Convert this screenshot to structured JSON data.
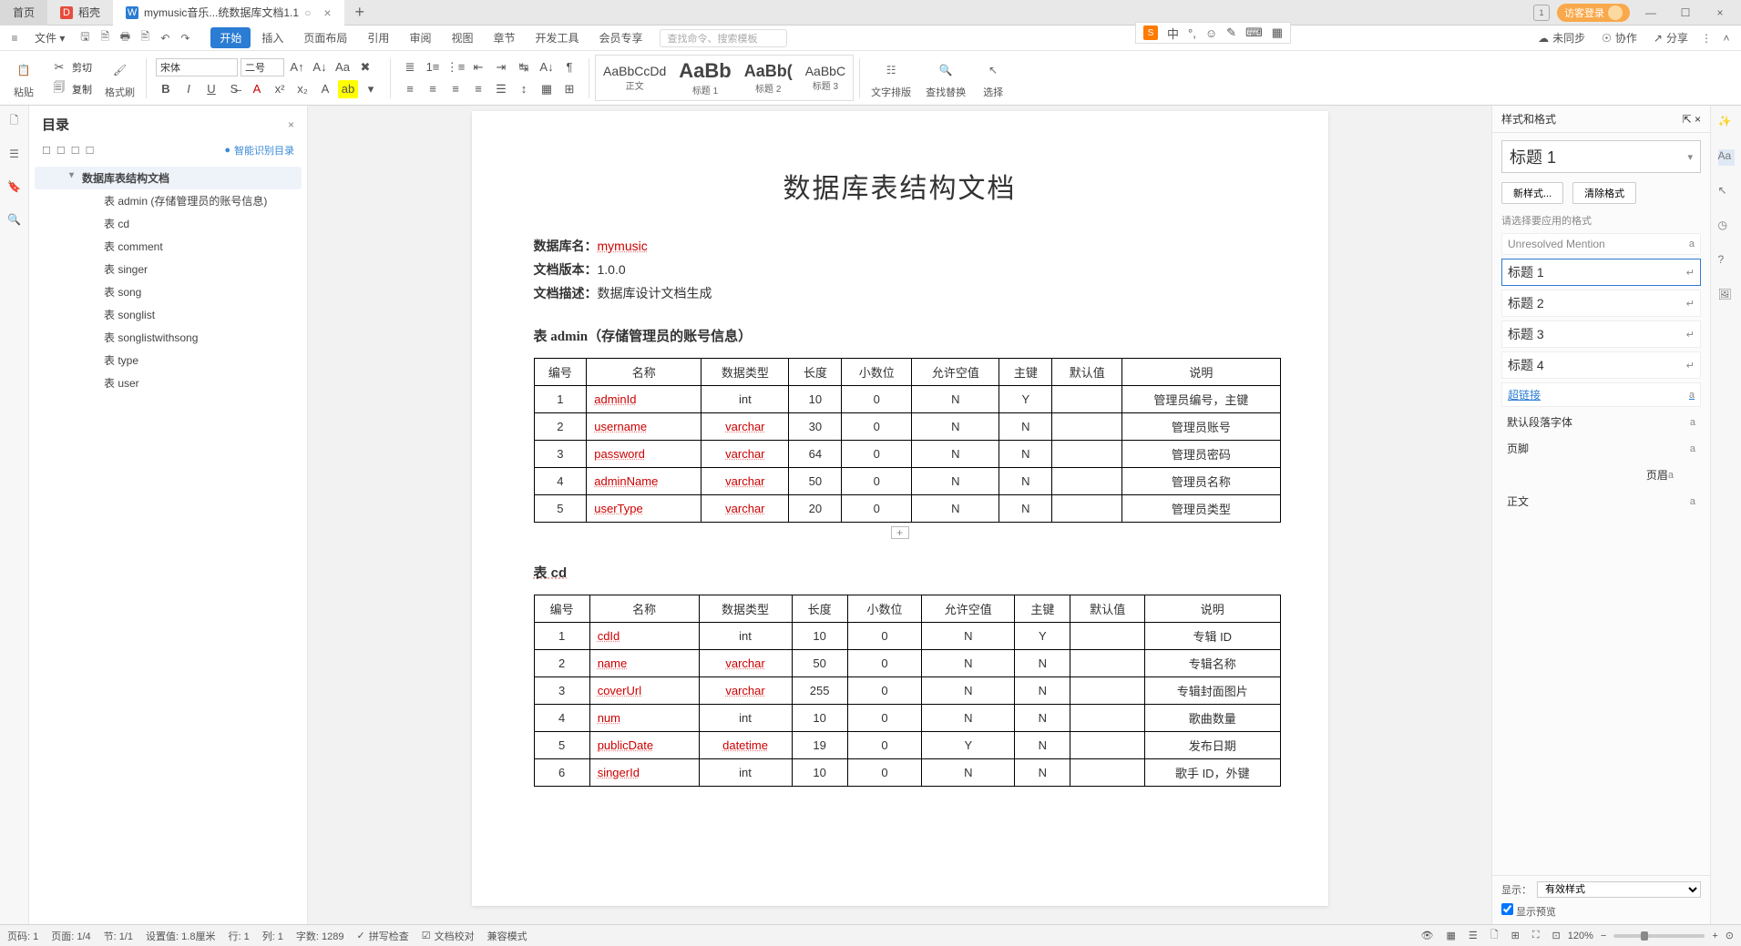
{
  "titlebar": {
    "home_tab": "首页",
    "shell_tab": "稻壳",
    "doc_tab": "mymusic音乐...统数据库文档1.1",
    "login": "访客登录"
  },
  "menubar": {
    "file": "文件",
    "start": "开始",
    "items": [
      "插入",
      "页面布局",
      "引用",
      "审阅",
      "视图",
      "章节",
      "开发工具",
      "会员专享"
    ],
    "search_ph": "查找命令、搜索模板",
    "right": {
      "sync": "未同步",
      "collab": "协作",
      "share": "分享"
    }
  },
  "ribbon": {
    "paste": "粘贴",
    "cut": "剪切",
    "copy": "复制",
    "fmt": "格式刷",
    "font": "宋体",
    "size": "二号",
    "styles": {
      "normal": "正文",
      "h1": "标题 1",
      "h2": "标题 2",
      "h3": "标题 3"
    },
    "text_layout": "文字排版",
    "find": "查找替换",
    "select": "选择"
  },
  "outline": {
    "title": "目录",
    "smart": "智能识别目录",
    "root": "数据库表结构文档",
    "items": [
      "表 admin (存储管理员的账号信息)",
      "表 cd",
      "表 comment",
      "表 singer",
      "表 song",
      "表 songlist",
      "表 songlistwithsong",
      "表 type",
      "表 user"
    ]
  },
  "doc": {
    "title": "数据库表结构文档",
    "db_label": "数据库名：",
    "db_name": "mymusic",
    "ver_label": "文档版本：",
    "ver": "1.0.0",
    "desc_label": "文档描述：",
    "desc": "数据库设计文档生成",
    "sect_admin": "表 admin（存储管理员的账号信息）",
    "sect_cd": "表 cd",
    "cols": [
      "编号",
      "名称",
      "数据类型",
      "长度",
      "小数位",
      "允许空值",
      "主键",
      "默认值",
      "说明"
    ],
    "admin_rows": [
      [
        "1",
        "adminId",
        "int",
        "10",
        "0",
        "N",
        "Y",
        "",
        "管理员编号，主键"
      ],
      [
        "2",
        "username",
        "varchar",
        "30",
        "0",
        "N",
        "N",
        "",
        "管理员账号"
      ],
      [
        "3",
        "password",
        "varchar",
        "64",
        "0",
        "N",
        "N",
        "",
        "管理员密码"
      ],
      [
        "4",
        "adminName",
        "varchar",
        "50",
        "0",
        "N",
        "N",
        "",
        "管理员名称"
      ],
      [
        "5",
        "userType",
        "varchar",
        "20",
        "0",
        "N",
        "N",
        "",
        "管理员类型"
      ]
    ],
    "cd_rows": [
      [
        "1",
        "cdId",
        "int",
        "10",
        "0",
        "N",
        "Y",
        "",
        "专辑 ID"
      ],
      [
        "2",
        "name",
        "varchar",
        "50",
        "0",
        "N",
        "N",
        "",
        "专辑名称"
      ],
      [
        "3",
        "coverUrl",
        "varchar",
        "255",
        "0",
        "N",
        "N",
        "",
        "专辑封面图片"
      ],
      [
        "4",
        "num",
        "int",
        "10",
        "0",
        "N",
        "N",
        "",
        "歌曲数量"
      ],
      [
        "5",
        "publicDate",
        "datetime",
        "19",
        "0",
        "Y",
        "N",
        "",
        "发布日期"
      ],
      [
        "6",
        "singerId",
        "int",
        "10",
        "0",
        "N",
        "N",
        "",
        "歌手 ID，外键"
      ]
    ]
  },
  "styles": {
    "panel": "样式和格式",
    "current": "标题 1",
    "new_style": "新样式...",
    "clear": "清除格式",
    "hint": "请选择要应用的格式",
    "items": [
      {
        "label": "Unresolved Mention",
        "cls": "gray"
      },
      {
        "label": "标题 1",
        "cls": "sel"
      },
      {
        "label": "标题 2",
        "cls": ""
      },
      {
        "label": "标题 3",
        "cls": ""
      },
      {
        "label": "标题 4",
        "cls": ""
      },
      {
        "label": "超链接",
        "cls": "link"
      },
      {
        "label": "默认段落字体",
        "cls": "small"
      },
      {
        "label": "页脚",
        "cls": "small"
      },
      {
        "label": "页眉",
        "cls": "small ta-r"
      },
      {
        "label": "正文",
        "cls": "small"
      }
    ],
    "show_label": "显示：",
    "show_value": "有效样式",
    "preview": "显示预览"
  },
  "statusbar": {
    "page_no": "页码: 1",
    "page": "页面: 1/4",
    "section": "节: 1/1",
    "pos": "设置值: 1.8厘米",
    "line": "行: 1",
    "col": "列: 1",
    "words": "字数: 1289",
    "spell": "拼写检查",
    "proof": "文档校对",
    "compat": "兼容模式",
    "zoom": "120%"
  }
}
